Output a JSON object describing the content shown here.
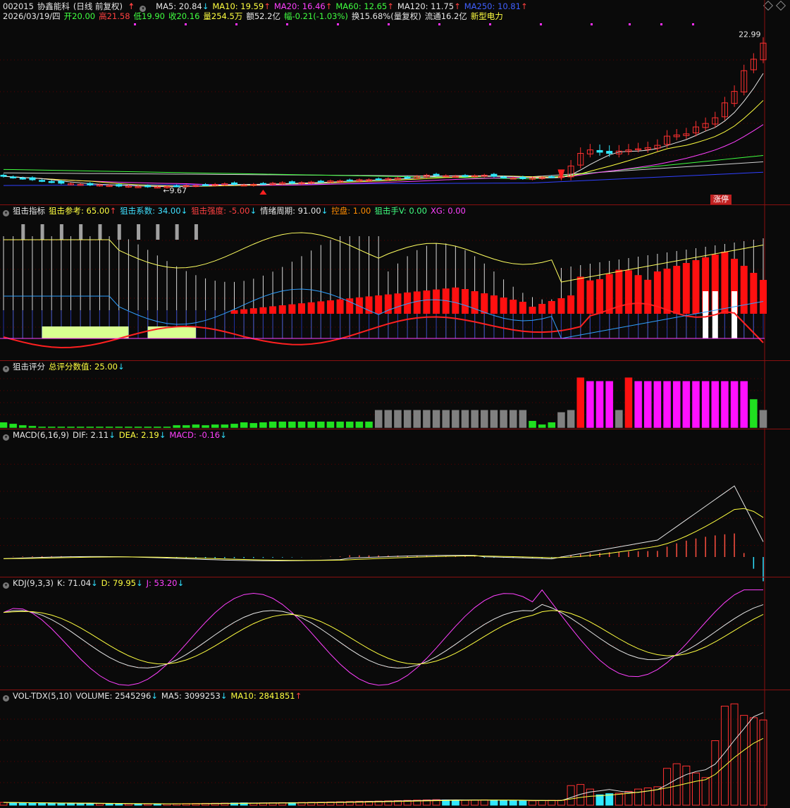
{
  "header": {
    "stock_code": "002015",
    "stock_name": "协鑫能科",
    "period_label": "(日线 前复权)",
    "ma_items": [
      {
        "label": "MA5: 20.84",
        "arrow": "↓",
        "color": "#e6e6e6",
        "dir": "down"
      },
      {
        "label": "MA10: 19.59",
        "arrow": "↑",
        "color": "#ffff40",
        "dir": "up"
      },
      {
        "label": "MA20: 16.46",
        "arrow": "↑",
        "color": "#ff40ff",
        "dir": "up"
      },
      {
        "label": "MA60: 12.65",
        "arrow": "↑",
        "color": "#40ff40",
        "dir": "up"
      },
      {
        "label": "MA120: 11.75",
        "arrow": "↑",
        "color": "#e6e6e6",
        "dir": "up"
      },
      {
        "label": "MA250: 10.81",
        "arrow": "↑",
        "color": "#4060ff",
        "dir": "up"
      }
    ],
    "quote": {
      "date": "2026/03/19/四",
      "open": "开20.00",
      "high": "高21.58",
      "low": "低19.90",
      "close": "收20.16",
      "volume": "量254.5万",
      "amount": "额52.2亿",
      "change": "幅-0.21(-1.03%)",
      "turnover": "换15.68%(量复权)",
      "float": "流通16.2亿",
      "sector": "新型电力"
    },
    "price_high_label": "22.99",
    "price_low_label": "9.67",
    "limit_tag": "涨停"
  },
  "panels": {
    "sniper": {
      "name": "狙击指标",
      "items": [
        {
          "label": "狙击参考: 65.00",
          "arrow": "↑",
          "color": "#ffff40"
        },
        {
          "label": "狙击系数: 34.00",
          "arrow": "↓",
          "color": "#40e0ff"
        },
        {
          "label": "狙击强度: -5.00",
          "arrow": "↓",
          "color": "#ff4040"
        },
        {
          "label": "情绪周期: 91.00",
          "arrow": "↓",
          "color": "#e6e6e6"
        },
        {
          "label": "控盘: 1.00",
          "arrow": "",
          "color": "#ff8c00"
        },
        {
          "label": "狙击手V: 0.00",
          "arrow": "",
          "color": "#40ff80"
        },
        {
          "label": "XG: 0.00",
          "arrow": "",
          "color": "#ff40ff"
        }
      ]
    },
    "score": {
      "name": "狙击评分",
      "items": [
        {
          "label": "总评分数值: 25.00",
          "arrow": "↓",
          "color": "#ffff40"
        }
      ]
    },
    "macd": {
      "name": "MACD(6,16,9)",
      "items": [
        {
          "label": "DIF: 2.11",
          "arrow": "↓",
          "color": "#e6e6e6"
        },
        {
          "label": "DEA: 2.19",
          "arrow": "↓",
          "color": "#ffff40"
        },
        {
          "label": "MACD: -0.16",
          "arrow": "↓",
          "color": "#ff40ff"
        }
      ]
    },
    "kdj": {
      "name": "KDJ(9,3,3)",
      "items": [
        {
          "label": "K: 71.04",
          "arrow": "↓",
          "color": "#e6e6e6"
        },
        {
          "label": "D: 79.95",
          "arrow": "↓",
          "color": "#ffff40"
        },
        {
          "label": "J: 53.20",
          "arrow": "↓",
          "color": "#ff40ff"
        }
      ]
    },
    "vol": {
      "name": "VOL-TDX(5,10)",
      "items": [
        {
          "label": "VOLUME: 2545296",
          "arrow": "↓",
          "color": "#e6e6e6"
        },
        {
          "label": "MA5: 3099253",
          "arrow": "↓",
          "color": "#e6e6e6"
        },
        {
          "label": "MA10: 2841851",
          "arrow": "↑",
          "color": "#ffff40"
        }
      ]
    }
  },
  "colors": {
    "up": "#ff3030",
    "down": "#30e8ff",
    "ma5": "#e6e6e6",
    "ma10": "#ffff40",
    "ma20": "#ff40ff",
    "ma60": "#40ff40",
    "ma120": "#d0d0d0",
    "ma250": "#3040ff",
    "separator": "#8a1010",
    "score_green": "#20e020",
    "score_gray": "#808080",
    "score_red": "#ff1010",
    "score_magenta": "#ff10ff"
  },
  "chart_data": [
    {
      "type": "candlestick",
      "title": "002015 协鑫能科 (日线 前复权)",
      "count": 80,
      "close": [
        10.6,
        10.5,
        10.4,
        10.3,
        10.2,
        10.1,
        10.0,
        9.95,
        9.9,
        9.85,
        9.85,
        9.8,
        9.75,
        9.75,
        9.7,
        9.7,
        9.67,
        9.7,
        9.75,
        9.8,
        9.8,
        9.85,
        9.9,
        9.95,
        9.9,
        9.85,
        9.9,
        9.95,
        10.0,
        10.05,
        10.0,
        10.05,
        10.1,
        10.15,
        10.2,
        10.2,
        10.25,
        10.3,
        10.3,
        10.35,
        10.4,
        10.45,
        10.5,
        10.6,
        10.7,
        10.7,
        10.65,
        10.6,
        10.6,
        10.65,
        10.7,
        10.6,
        10.5,
        10.45,
        10.4,
        10.45,
        10.5,
        10.55,
        10.6,
        11.5,
        12.6,
        12.9,
        12.7,
        12.6,
        12.8,
        12.9,
        13.0,
        13.1,
        13.3,
        14.1,
        14.2,
        14.3,
        14.9,
        15.2,
        15.7,
        17.0,
        18.0,
        19.8,
        20.8,
        22.2
      ],
      "ylim": [
        9.5,
        23.5
      ]
    },
    {
      "type": "bar",
      "title": "狙击评分",
      "values": [
        8,
        6,
        4,
        3,
        2,
        2,
        2,
        2,
        2,
        2,
        2,
        2,
        2,
        2,
        2,
        2,
        2,
        2,
        4,
        4,
        5,
        4,
        5,
        5,
        6,
        8,
        7,
        8,
        9,
        9,
        9,
        9,
        9,
        9,
        9,
        9,
        9,
        9,
        9,
        25,
        25,
        25,
        25,
        25,
        25,
        25,
        25,
        25,
        25,
        25,
        25,
        25,
        25,
        25,
        25,
        10,
        5,
        8,
        22,
        25,
        70,
        65,
        65,
        65,
        25,
        70,
        65,
        65,
        65,
        65,
        65,
        65,
        65,
        65,
        65,
        65,
        65,
        65,
        40,
        25
      ],
      "ylim": [
        0,
        80
      ]
    },
    {
      "type": "bar",
      "title": "VOLUME",
      "values": [
        120,
        110,
        100,
        95,
        90,
        85,
        80,
        80,
        75,
        70,
        70,
        65,
        60,
        60,
        60,
        55,
        55,
        60,
        65,
        70,
        75,
        80,
        85,
        90,
        95,
        100,
        95,
        100,
        105,
        110,
        110,
        120,
        125,
        130,
        140,
        150,
        160,
        170,
        170,
        180,
        190,
        200,
        210,
        220,
        230,
        240,
        230,
        220,
        210,
        220,
        230,
        220,
        210,
        200,
        190,
        190,
        200,
        210,
        210,
        850,
        900,
        700,
        450,
        500,
        520,
        600,
        700,
        750,
        800,
        1600,
        1800,
        1700,
        1400,
        1200,
        2800,
        4300,
        4400,
        3900,
        3800,
        3700
      ],
      "ylim": [
        0,
        4500
      ]
    }
  ]
}
